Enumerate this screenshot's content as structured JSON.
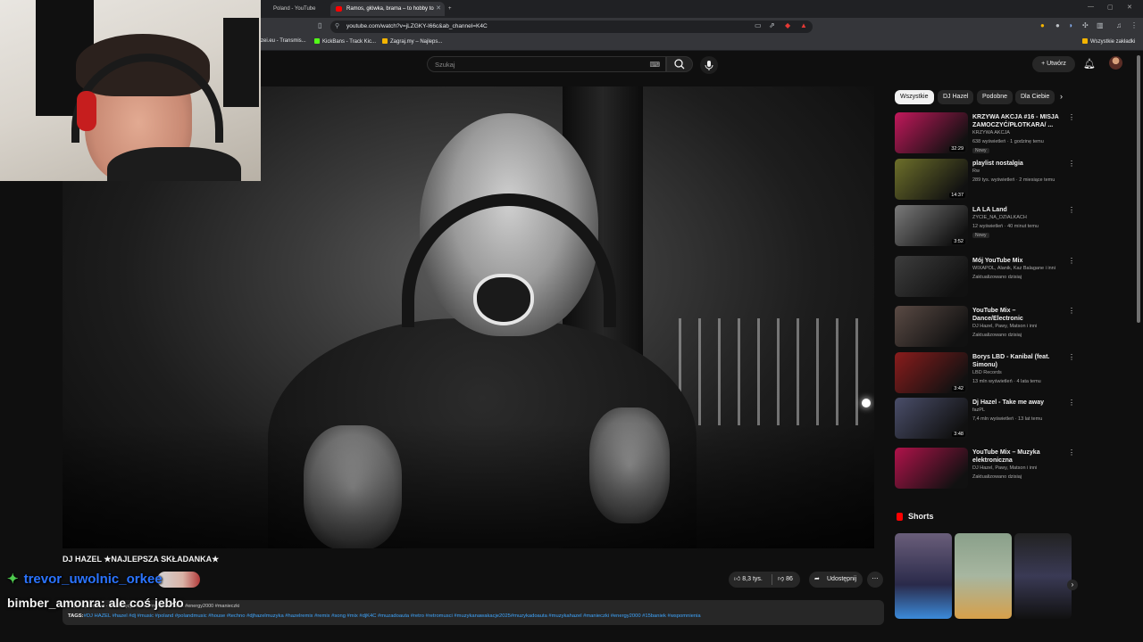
{
  "browser": {
    "tabs": [
      {
        "label": "Poland - YouTube"
      },
      {
        "label": "Ramos, główka, brama – to hobby to"
      }
    ],
    "url": "youtube.com/watch?v=jLZGKY-I66c&ab_channel=K4C",
    "bookmarks": [
      "zei.eu - Transmis...",
      "KickBans - Track Kic...",
      "Zagraj.my – Najleps..."
    ],
    "all_bookmarks": "Wszystkie zakładki"
  },
  "youtube": {
    "search_placeholder": "Szukaj",
    "create_label": "Utwórz"
  },
  "video": {
    "title": "DJ HAZEL ★NAJLEPSZA SKŁADANKA★",
    "likes": "8,3 tys.",
    "dislikes": "86",
    "share_label": "Udostępnij",
    "desc_line1": "7 tys. wyświetleń · 9 miesięcy temu · #muzykadoauta #energy2000 #manieczki",
    "desc_tags_label": "TAGS:",
    "desc_tags": "#DJ HAZEL #hazel #dj #music #poland #polandmusic #house #techno #djhazelmuzyka #hazelremix #remix #song #mix #djK4C #muzadoauta  #retro #retromusci #muzykanawakacje2025#muzykadoauta #muzykahazel #manieczki #energy2000 #15baniek #wspomnienia"
  },
  "chips": [
    "Wszystkie",
    "DJ Hazel",
    "Podobne",
    "Dla Ciebie"
  ],
  "recommendations": [
    {
      "title": "KRZYWA AKCJA #16 - MISJA ZAMOCZYĆ/PŁOTKARA/ ...",
      "channel": "KRZYWA AKCJA",
      "meta": "638 wyświetleń · 1 godzinę temu",
      "badge": "Nowy",
      "duration": "32:29",
      "thumb": "#c2185b"
    },
    {
      "title": "playlist nostalgia",
      "channel": "Rw",
      "meta": "289 tys. wyświetleń · 2 miesiące temu",
      "badge": "",
      "duration": "14:37",
      "thumb": "#6d6f2a"
    },
    {
      "title": "LA LA Land",
      "channel": "ZYCIE_NA_DZIALKACH",
      "meta": "12 wyświetleń · 40 minut temu",
      "badge": "Nowy",
      "duration": "3:52",
      "thumb": "#7a7a7a"
    },
    {
      "title": "Mój YouTube Mix",
      "channel": "WIXAPOL, Alanik, Kaz Balagane i inni",
      "meta": "Zaktualizowano dzisiaj",
      "badge": "",
      "duration": "",
      "thumb": "#3d3d3d"
    },
    {
      "title": "YouTube Mix – Dance/Electronic",
      "channel": "DJ Hazel, Pawy, Matson i inni",
      "meta": "Zaktualizowano dzisiaj",
      "badge": "",
      "duration": "",
      "thumb": "#5a4a44"
    },
    {
      "title": "Borys LBD - Kanibal (feat. Simonu)",
      "channel": "LBD Records",
      "meta": "13 mln wyświetleń · 4 lata temu",
      "badge": "",
      "duration": "3:42",
      "thumb": "#8a1c1c"
    },
    {
      "title": "Dj Hazel - Take me away",
      "channel": "fazPL",
      "meta": "7,4 mln wyświetleń · 13 lat temu",
      "badge": "",
      "duration": "3:48",
      "thumb": "#4a4e6a"
    },
    {
      "title": "YouTube Mix – Muzyka elektroniczna",
      "channel": "DJ Hazel, Pawy, Matson i inni",
      "meta": "Zaktualizowano dzisiaj",
      "badge": "",
      "duration": "",
      "thumb": "#b0124a"
    }
  ],
  "shorts": {
    "heading": "Shorts"
  },
  "chat": {
    "msg1_user": "trevor_uwolnic_orkee",
    "msg2_user": "bimber_amonra",
    "msg2_text": ": ale coś jebło"
  },
  "colors": {
    "accent": "#ff0000",
    "chat_name": "#2b74ff",
    "tag_link": "#3ea6ff"
  }
}
